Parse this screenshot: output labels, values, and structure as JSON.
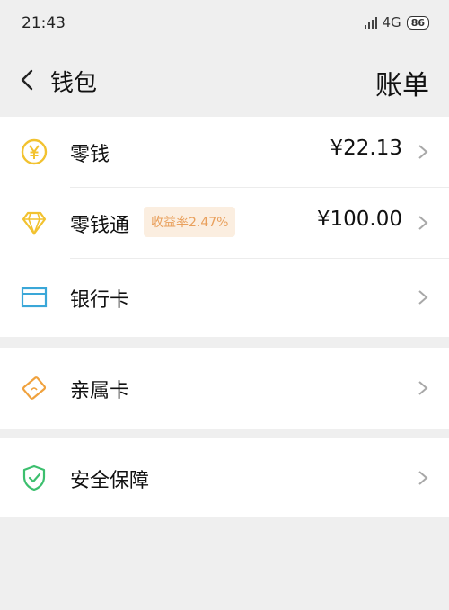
{
  "status": {
    "time": "21:43",
    "network": "4G",
    "battery": "86"
  },
  "nav": {
    "title": "钱包",
    "bill": "账单"
  },
  "rows": [
    {
      "label": "零钱",
      "amount": "¥22.13",
      "icon": "yen-coin-icon"
    },
    {
      "label": "零钱通",
      "amount": "¥100.00",
      "badge": "收益率2.47%",
      "icon": "diamond-icon"
    },
    {
      "label": "银行卡",
      "icon": "bank-card-icon"
    },
    {
      "label": "亲属卡",
      "icon": "family-card-icon"
    },
    {
      "label": "安全保障",
      "icon": "shield-check-icon"
    }
  ],
  "colors": {
    "coin": "#f2c230",
    "card": "#3aa7d8",
    "family": "#f0a23e",
    "shield": "#3cbf6e",
    "badge_bg": "#fbeee0",
    "badge_text": "#e9a05c"
  }
}
